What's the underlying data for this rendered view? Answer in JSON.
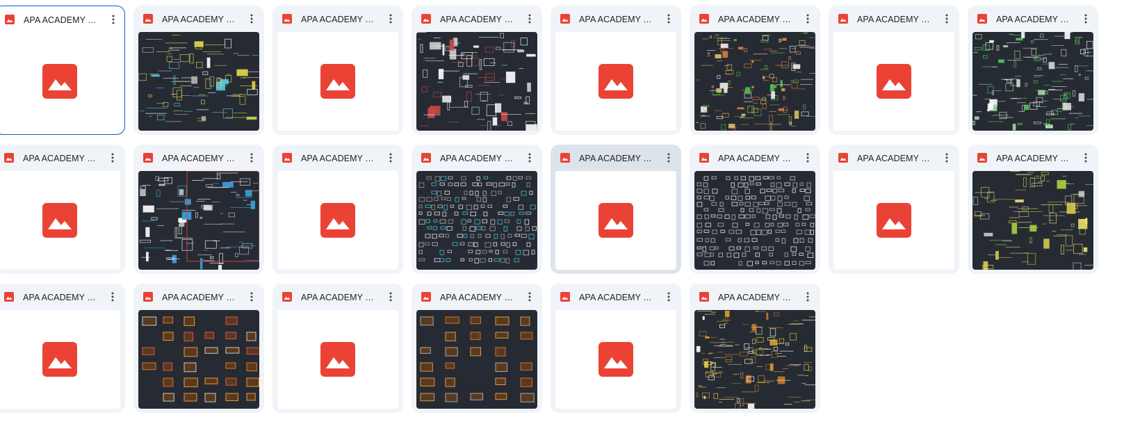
{
  "cards": [
    {
      "title": "APA ACADEMY THƯ VIỆN...",
      "thumb": "placeholder",
      "state": "selected"
    },
    {
      "title": "APA ACADEMY THƯ VIỆN...",
      "thumb": "cad-ceiling",
      "state": "normal"
    },
    {
      "title": "APA ACADEMY THƯ VIỆN...",
      "thumb": "placeholder",
      "state": "normal"
    },
    {
      "title": "APA ACADEMY THƯ VIỆN...",
      "thumb": "cad-furniture-plan",
      "state": "normal"
    },
    {
      "title": "APA ACADEMY THƯ VIỆN...",
      "thumb": "placeholder",
      "state": "normal"
    },
    {
      "title": "APA ACADEMY THƯ VIỆN...",
      "thumb": "cad-people-plants",
      "state": "normal"
    },
    {
      "title": "APA ACADEMY THƯ VIỆN...",
      "thumb": "placeholder",
      "state": "normal"
    },
    {
      "title": "APA ACADEMY THƯ VIỆN...",
      "thumb": "cad-green-blocks",
      "state": "normal"
    },
    {
      "title": "APA ACADEMY THƯ VIỆN...",
      "thumb": "placeholder",
      "state": "normal"
    },
    {
      "title": "APA ACADEMY THƯ VIỆN...",
      "thumb": "cad-blocks-red-frame",
      "state": "normal"
    },
    {
      "title": "APA ACADEMY THƯ VIỆN...",
      "thumb": "placeholder",
      "state": "normal"
    },
    {
      "title": "APA ACADEMY THƯ VIỆN...",
      "thumb": "cad-sanitary-grid",
      "state": "normal"
    },
    {
      "title": "APA ACADEMY THƯ VIỆN...",
      "thumb": "placeholder",
      "state": "hovered"
    },
    {
      "title": "APA ACADEMY THƯ VIỆN...",
      "thumb": "cad-symbol-rows",
      "state": "normal"
    },
    {
      "title": "APA ACADEMY THƯ VIỆN...",
      "thumb": "placeholder",
      "state": "normal"
    },
    {
      "title": "APA ACADEMY THƯ VIỆN...",
      "thumb": "cad-yellow-details",
      "state": "normal"
    },
    {
      "title": "APA ACADEMY THƯ VIỆN...",
      "thumb": "placeholder",
      "state": "normal"
    },
    {
      "title": "APA ACADEMY THƯ VIỆN...",
      "thumb": "cad-orange-grid",
      "state": "normal"
    },
    {
      "title": "APA ACADEMY THƯ VIỆN...",
      "thumb": "placeholder",
      "state": "normal"
    },
    {
      "title": "APA ACADEMY THƯ VIỆN...",
      "thumb": "cad-orange-sparse",
      "state": "normal"
    },
    {
      "title": "APA ACADEMY THƯ VIỆN...",
      "thumb": "placeholder",
      "state": "normal"
    },
    {
      "title": "APA ACADEMY THƯ VIỆN...",
      "thumb": "cad-yellow-dense",
      "state": "normal"
    }
  ],
  "icons": {
    "file_type": "image-file-icon",
    "more": "more-vert-icon",
    "placeholder": "image-placeholder-icon"
  },
  "colors": {
    "card_bg": "#f0f4f9",
    "card_hover_bg": "#dde3ea",
    "selection_border": "#0b57d0",
    "image_icon_red": "#ea4335",
    "cad_bg": "#262b33"
  }
}
